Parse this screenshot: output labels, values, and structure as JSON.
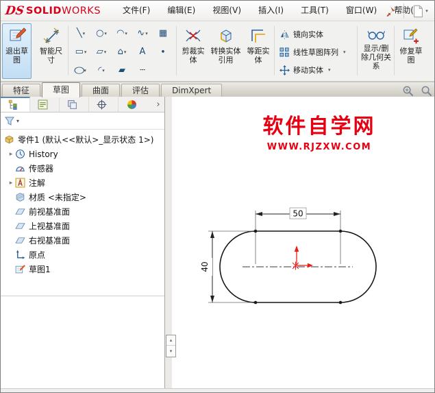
{
  "titlebar": {
    "logo_mark": "DS",
    "logo_solid": "SOLID",
    "logo_works": "WORKS",
    "menus": [
      "文件(F)",
      "编辑(E)",
      "视图(V)",
      "插入(I)",
      "工具(T)",
      "窗口(W)",
      "帮助(H)"
    ]
  },
  "ribbon": {
    "exit_sketch": "退出草图",
    "smart_dimension": "智能尺寸",
    "trim_entities": "剪裁实体",
    "convert_entities": "转换实体引用",
    "offset_entities": "等距实体",
    "mirror_entities": "镜向实体",
    "linear_pattern": "线性草图阵列",
    "move_entities": "移动实体",
    "display_delete_relations": "显示/删除几何关系",
    "repair_sketch": "修复草图",
    "tools": [
      {
        "name": "line",
        "glyph": "╲"
      },
      {
        "name": "circle",
        "glyph": "○"
      },
      {
        "name": "arc",
        "glyph": "◠"
      },
      {
        "name": "spline",
        "glyph": "∿"
      },
      {
        "name": "sketch-picture",
        "glyph": "▦"
      },
      {
        "name": "rectangle",
        "glyph": "▭"
      },
      {
        "name": "slot",
        "glyph": "▱"
      },
      {
        "name": "polygon",
        "glyph": "⌂"
      },
      {
        "name": "text",
        "glyph": "A"
      },
      {
        "name": "point",
        "glyph": "∙"
      },
      {
        "name": "ellipse",
        "glyph": "○"
      },
      {
        "name": "fillet",
        "glyph": "◜"
      },
      {
        "name": "plane",
        "glyph": "▰"
      },
      {
        "name": "centerline",
        "glyph": "┄"
      }
    ]
  },
  "command_tabs": [
    {
      "label": "特征"
    },
    {
      "label": "草图"
    },
    {
      "label": "曲面"
    },
    {
      "label": "评估"
    },
    {
      "label": "DimXpert"
    }
  ],
  "tree": {
    "root": "零件1 (默认<<默认>_显示状态 1>)",
    "items": [
      {
        "label": "History"
      },
      {
        "label": "传感器"
      },
      {
        "label": "注解"
      },
      {
        "label": "材质 <未指定>"
      },
      {
        "label": "前视基准面"
      },
      {
        "label": "上视基准面"
      },
      {
        "label": "右视基准面"
      },
      {
        "label": "原点"
      },
      {
        "label": "草图1"
      }
    ]
  },
  "canvas": {
    "watermark_title": "软件自学网",
    "watermark_url": "WWW.RJZXW.COM",
    "dim_width": "50",
    "dim_height": "40"
  },
  "icons": {
    "caret": "▾",
    "expander": "▸",
    "tab_overflow": "›",
    "splitter_up": "▴",
    "splitter_down": "▾"
  },
  "colors": {
    "brand_red": "#d6001c",
    "watermark_red": "#e60012",
    "origin_red": "#ee1c12",
    "selection_blue": "#7da7cd"
  }
}
